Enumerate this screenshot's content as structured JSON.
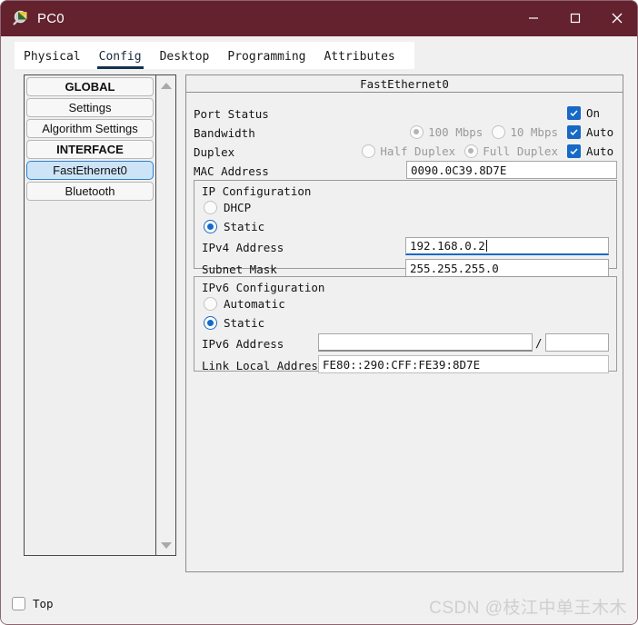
{
  "window": {
    "title": "PC0",
    "icon": "packet-tracer-logo-icon",
    "controls": {
      "minimize": "minimize-icon",
      "maximize": "maximize-icon",
      "close": "close-icon"
    }
  },
  "tabs": [
    {
      "label": "Physical",
      "active": false
    },
    {
      "label": "Config",
      "active": true
    },
    {
      "label": "Desktop",
      "active": false
    },
    {
      "label": "Programming",
      "active": false
    },
    {
      "label": "Attributes",
      "active": false
    }
  ],
  "sidebar": {
    "items": [
      {
        "label": "GLOBAL",
        "type": "header",
        "selected": false
      },
      {
        "label": "Settings",
        "type": "item",
        "selected": false
      },
      {
        "label": "Algorithm Settings",
        "type": "item",
        "selected": false
      },
      {
        "label": "INTERFACE",
        "type": "header",
        "selected": false
      },
      {
        "label": "FastEthernet0",
        "type": "item",
        "selected": true
      },
      {
        "label": "Bluetooth",
        "type": "item",
        "selected": false
      }
    ],
    "scrollbar": {
      "up_arrow": "scroll-up-arrow-icon",
      "down_arrow": "scroll-down-arrow-icon"
    }
  },
  "main": {
    "interface_title": "FastEthernet0",
    "port_status": {
      "label": "Port Status",
      "on_label": "On",
      "on_checked": true
    },
    "bandwidth": {
      "label": "Bandwidth",
      "option_100": "100 Mbps",
      "option_10": "10 Mbps",
      "selected": "100 Mbps",
      "auto_label": "Auto",
      "auto_checked": true
    },
    "duplex": {
      "label": "Duplex",
      "option_half": "Half Duplex",
      "option_full": "Full Duplex",
      "selected": "Full Duplex",
      "auto_label": "Auto",
      "auto_checked": true
    },
    "mac": {
      "label": "MAC Address",
      "value": "0090.0C39.8D7E"
    },
    "ip_config": {
      "title": "IP Configuration",
      "dhcp_label": "DHCP",
      "static_label": "Static",
      "selected": "Static",
      "ipv4_label": "IPv4 Address",
      "ipv4_value": "192.168.0.2",
      "ipv4_focused": true,
      "subnet_label": "Subnet Mask",
      "subnet_value": "255.255.255.0"
    },
    "ipv6_config": {
      "title": "IPv6 Configuration",
      "automatic_label": "Automatic",
      "static_label": "Static",
      "selected": "Static",
      "ipv6_label": "IPv6 Address",
      "ipv6_value": "",
      "prefix_separator": "/",
      "prefix_value": "",
      "link_local_label": "Link Local Address:",
      "link_local_value": "FE80::290:CFF:FE39:8D7E"
    }
  },
  "bottom": {
    "top_label": "Top",
    "top_checked": false,
    "watermark": "CSDN @枝江中单王木木"
  },
  "colors": {
    "titlebar": "#63222e",
    "accent_blue": "#1669c6",
    "tab_underline": "#14304f",
    "selected_item_bg": "#cde4f7",
    "panel_bg": "#f0f0f0"
  }
}
